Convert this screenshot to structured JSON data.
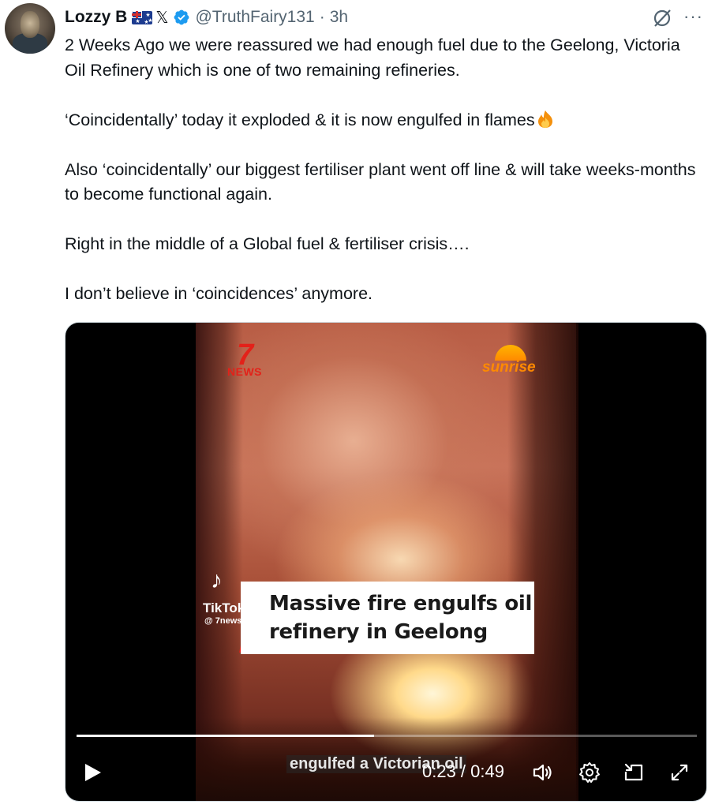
{
  "post": {
    "author_name": "Lozzy B",
    "author_handle": "@TruthFairy131",
    "separator": "·",
    "timestamp": "3h",
    "more_label": "···",
    "paragraphs": [
      "2 Weeks Ago we were reassured we had enough fuel due to the Geelong, Victoria Oil Refinery which is one of two remaining refineries.",
      "‘Coincidentally’ today it exploded & it is now engulfed in flames",
      "Also ‘coincidentally’ our biggest fertiliser plant went off line & will take weeks-months to become functional again.",
      "Right in the middle of a Global fuel & fertiliser crisis….",
      "I don’t believe in ‘coincidences’ anymore."
    ]
  },
  "video": {
    "logo_7": "7",
    "logo_news": "NEWS",
    "logo_sunrise": "sunrise",
    "tiktok_label": "TikTok",
    "tiktok_user": "@ 7news",
    "caption_line1": "Massive fire engulfs oil",
    "caption_line2": "refinery in Geelong",
    "subtitle": "engulfed a Victorian oil",
    "current_time": "0:23",
    "duration": "0:49",
    "time_display": "0:23 / 0:49",
    "progress": 0.48
  },
  "icons": {
    "verified": "verified-badge-icon",
    "grok": "grok-icon",
    "more": "more-icon",
    "play": "play-icon",
    "volume": "volume-icon",
    "settings": "settings-gear-icon",
    "pip": "picture-in-picture-icon",
    "fullscreen": "fullscreen-icon",
    "fire": "fire-emoji-icon",
    "flag": "australia-flag-icon",
    "x": "x-logo-icon"
  },
  "colors": {
    "text": "#0f1419",
    "secondary_text": "#536471",
    "verified_blue": "#1d9bf0",
    "news_red": "#e32119",
    "sunrise_orange": "#ff8a00"
  }
}
